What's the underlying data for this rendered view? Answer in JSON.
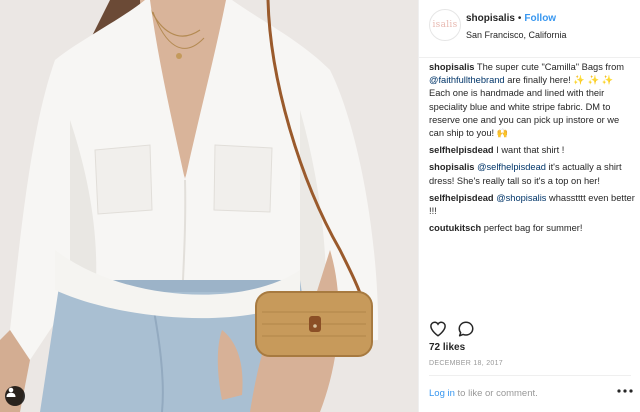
{
  "post": {
    "username": "shopisalis",
    "follow_label": "Follow",
    "header_separator": "•",
    "location": "San Francisco, California",
    "avatar_text": "isalis",
    "caption": {
      "author": "shopisalis",
      "text_1": " The super cute \"Camilla\" Bags from ",
      "mention": "@faithfullthebrand",
      "text_2": " are finally here! ✨ ✨ ✨ Each one is handmade and lined with their speciality blue and white stripe fabric. DM to reserve one and you can pick up instore or we can ship to you! 🙌"
    },
    "comments": [
      {
        "author": "selfhelpisdead",
        "pre": " I want that shirt !",
        "mention": "",
        "post": ""
      },
      {
        "author": "shopisalis",
        "pre": " ",
        "mention": "@selfhelpisdead",
        "post": " it's actually a shirt dress! She's really tall so it's a top on her!"
      },
      {
        "author": "selfhelpisdead",
        "pre": " ",
        "mention": "@shopisalis",
        "post": " whasstttt even better !!!"
      },
      {
        "author": "coutukitsch",
        "pre": " perfect bag for summer!",
        "mention": "",
        "post": ""
      }
    ],
    "likes": "72 likes",
    "date": "DECEMBER 18, 2017",
    "footer": {
      "login_label": "Log in",
      "rest": " to like or comment."
    }
  },
  "icons": {
    "like": "heart-outline-icon",
    "comment": "speech-bubble-icon",
    "more": "ellipsis-icon",
    "tag": "person-tag-icon"
  },
  "colors": {
    "link_blue": "#3897f0",
    "mention_blue": "#003569",
    "muted_gray": "#999999",
    "text": "#262626"
  }
}
